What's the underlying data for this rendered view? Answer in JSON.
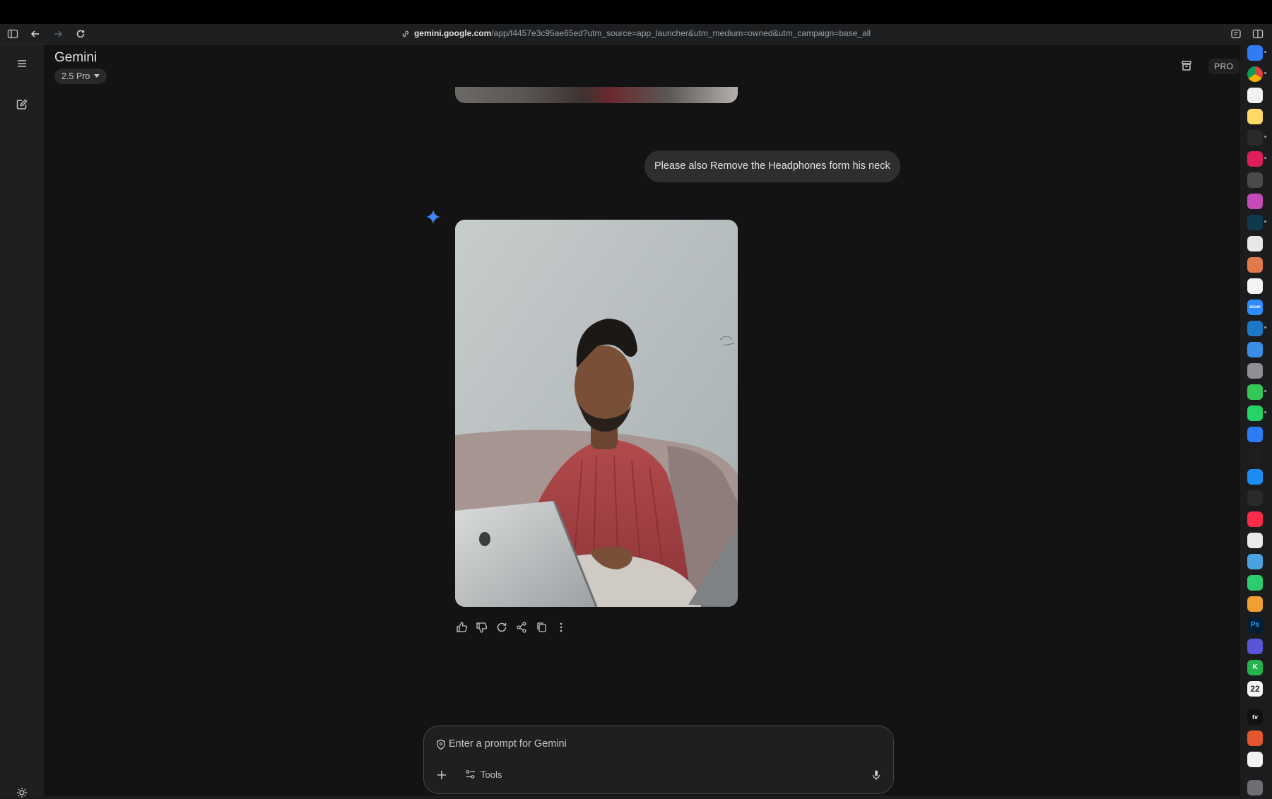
{
  "browser": {
    "url_host": "gemini.google.com",
    "url_path": "/app/f4457e3c95ae65ed?utm_source=app_launcher&utm_medium=owned&utm_campaign=base_all"
  },
  "header": {
    "app_title": "Gemini",
    "model_label": "2.5 Pro",
    "pro_badge": "PRO"
  },
  "conversation": {
    "user_message": "Please also Remove the Headphones form his neck"
  },
  "prompt": {
    "placeholder": "Enter a prompt for Gemini",
    "tools_label": "Tools"
  },
  "dock": {
    "calendar_day": "22",
    "tv_label": "tv",
    "ps_label": "Ps",
    "k_label": "K",
    "zoom_label": "zoom"
  },
  "colors": {
    "accent_blue": "#4285f4",
    "background": "#131314",
    "user_bubble": "#2d2e30"
  }
}
